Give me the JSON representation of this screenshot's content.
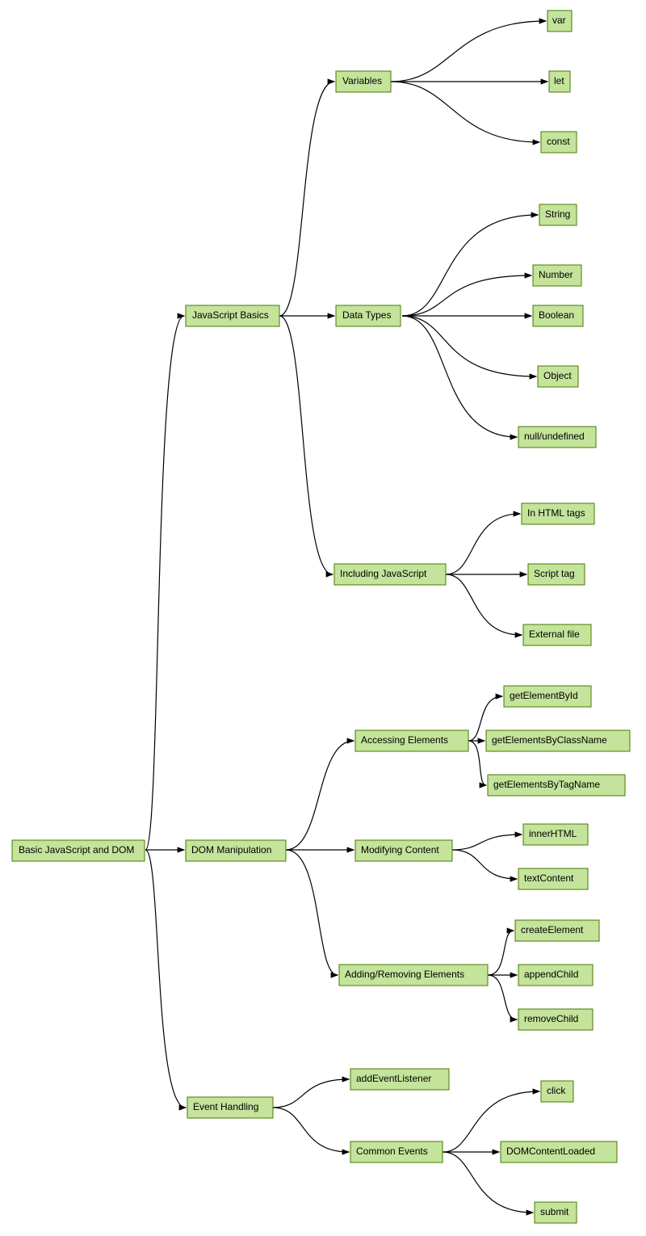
{
  "chart_data": {
    "type": "tree",
    "root": "Basic JavaScript and DOM",
    "children": [
      {
        "label": "JavaScript Basics",
        "children": [
          {
            "label": "Variables",
            "children": [
              {
                "label": "var"
              },
              {
                "label": "let"
              },
              {
                "label": "const"
              }
            ]
          },
          {
            "label": "Data Types",
            "children": [
              {
                "label": "String"
              },
              {
                "label": "Number"
              },
              {
                "label": "Boolean"
              },
              {
                "label": "Object"
              },
              {
                "label": "null/undefined"
              }
            ]
          },
          {
            "label": "Including JavaScript",
            "children": [
              {
                "label": "In HTML tags"
              },
              {
                "label": "Script tag"
              },
              {
                "label": "External file"
              }
            ]
          }
        ]
      },
      {
        "label": "DOM Manipulation",
        "children": [
          {
            "label": "Accessing Elements",
            "children": [
              {
                "label": "getElementById"
              },
              {
                "label": "getElementsByClassName"
              },
              {
                "label": "getElementsByTagName"
              }
            ]
          },
          {
            "label": "Modifying Content",
            "children": [
              {
                "label": "innerHTML"
              },
              {
                "label": "textContent"
              }
            ]
          },
          {
            "label": "Adding/Removing Elements",
            "children": [
              {
                "label": "createElement"
              },
              {
                "label": "appendChild"
              },
              {
                "label": "removeChild"
              }
            ]
          }
        ]
      },
      {
        "label": "Event Handling",
        "children": [
          {
            "label": "addEventListener"
          },
          {
            "label": "Common Events",
            "children": [
              {
                "label": "click"
              },
              {
                "label": "DOMContentLoaded"
              },
              {
                "label": "submit"
              }
            ]
          }
        ]
      }
    ]
  },
  "nodes": {
    "root": "Basic JavaScript and DOM",
    "js_basics": "JavaScript Basics",
    "variables": "Variables",
    "var": "var",
    "let": "let",
    "const": "const",
    "data_types": "Data Types",
    "string": "String",
    "number": "Number",
    "boolean": "Boolean",
    "object": "Object",
    "null_undef": "null/undefined",
    "including_js": "Including JavaScript",
    "in_html": "In HTML tags",
    "script_tag": "Script tag",
    "ext_file": "External file",
    "dom_manip": "DOM Manipulation",
    "accessing": "Accessing Elements",
    "getid": "getElementById",
    "getclass": "getElementsByClassName",
    "gettag": "getElementsByTagName",
    "modifying": "Modifying Content",
    "innerhtml": "innerHTML",
    "textcontent": "textContent",
    "addremove": "Adding/Removing Elements",
    "createel": "createElement",
    "appendch": "appendChild",
    "removech": "removeChild",
    "evt_handling": "Event Handling",
    "addlistener": "addEventListener",
    "common_evt": "Common Events",
    "click": "click",
    "domloaded": "DOMContentLoaded",
    "submit": "submit"
  }
}
